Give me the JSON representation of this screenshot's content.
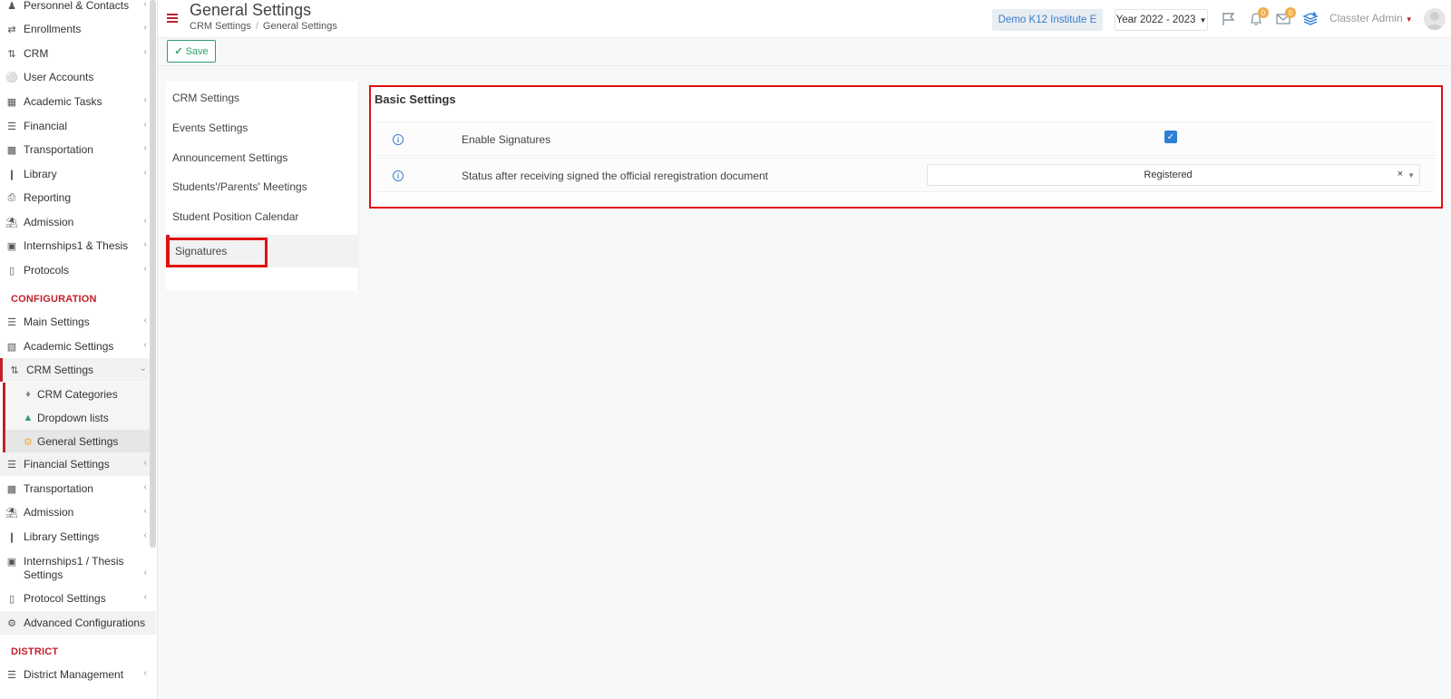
{
  "sidebar": {
    "items": [
      {
        "label": "Personnel & Contacts",
        "icon": "people-icon"
      },
      {
        "label": "Enrollments",
        "icon": "transfer-icon"
      },
      {
        "label": "CRM",
        "icon": "shuffle-icon"
      },
      {
        "label": "User Accounts",
        "icon": "key-icon"
      },
      {
        "label": "Academic Tasks",
        "icon": "grid-icon"
      },
      {
        "label": "Financial",
        "icon": "coins-icon"
      },
      {
        "label": "Transportation",
        "icon": "bus-icon"
      },
      {
        "label": "Library",
        "icon": "books-icon"
      },
      {
        "label": "Reporting",
        "icon": "printer-icon"
      },
      {
        "label": "Admission",
        "icon": "institution-icon"
      },
      {
        "label": "Internships1 & Thesis",
        "icon": "box-icon"
      },
      {
        "label": "Protocols",
        "icon": "archive-icon"
      }
    ],
    "config_section": "CONFIGURATION",
    "config_items": [
      {
        "label": "Main Settings",
        "icon": "sliders-icon"
      },
      {
        "label": "Academic Settings",
        "icon": "sitemap-icon"
      },
      {
        "label": "CRM Settings",
        "icon": "shuffle-icon"
      }
    ],
    "crm_sub": [
      {
        "label": "CRM Categories",
        "icon": "tags-icon"
      },
      {
        "label": "Dropdown lists",
        "icon": "layers-icon"
      },
      {
        "label": "General Settings",
        "icon": "gear-icon"
      }
    ],
    "config_items_2": [
      {
        "label": "Financial Settings",
        "icon": "coins-icon"
      },
      {
        "label": "Transportation",
        "icon": "bus-icon"
      },
      {
        "label": "Admission",
        "icon": "institution-icon"
      },
      {
        "label": "Library Settings",
        "icon": "books-icon"
      },
      {
        "label": "Internships1 / Thesis Settings",
        "icon": "box-icon"
      },
      {
        "label": "Protocol Settings",
        "icon": "archive-icon"
      },
      {
        "label": "Advanced Configurations",
        "icon": "gears-icon"
      }
    ],
    "district_section": "DISTRICT",
    "district_items": [
      {
        "label": "District Management",
        "icon": "list-icon"
      }
    ]
  },
  "header": {
    "title": "General Settings",
    "breadcrumb": [
      "CRM Settings",
      "General Settings"
    ],
    "institute": "Demo K12 Institute E",
    "year": "Year 2022 - 2023",
    "notifications_count": "0",
    "messages_count": "0",
    "user": "Classter Admin"
  },
  "toolbar": {
    "save_label": "Save"
  },
  "settings_menu": [
    "CRM Settings",
    "Events Settings",
    "Announcement Settings",
    "Students'/Parents' Meetings",
    "Student Position Calendar",
    "Signatures"
  ],
  "panel": {
    "title": "Basic Settings",
    "rows": [
      {
        "label": "Enable Signatures",
        "checked": true
      },
      {
        "label": "Status after receiving signed the official reregistration document",
        "value": "Registered"
      }
    ]
  },
  "colors": {
    "accent": "#c0202b",
    "primary": "#2d7fd4",
    "success": "#2e9e6b",
    "highlight": "#e01010"
  }
}
